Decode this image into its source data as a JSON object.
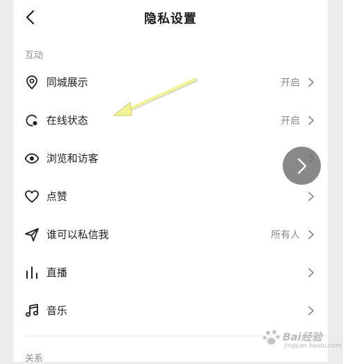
{
  "header": {
    "title": "隐私设置"
  },
  "sections": [
    {
      "label": "互动"
    },
    {
      "label": "关系"
    }
  ],
  "rows": [
    {
      "label": "同城展示",
      "value": "开启",
      "icon": "location-pin-icon"
    },
    {
      "label": "在线状态",
      "value": "开启",
      "icon": "online-status-icon"
    },
    {
      "label": "浏览和访客",
      "value": "",
      "icon": "eye-icon"
    },
    {
      "label": "点赞",
      "value": "",
      "icon": "heart-icon"
    },
    {
      "label": "谁可以私信我",
      "value": "所有人",
      "icon": "send-icon"
    },
    {
      "label": "直播",
      "value": "",
      "icon": "bars-icon"
    },
    {
      "label": "音乐",
      "value": "",
      "icon": "music-note-icon"
    }
  ],
  "watermark": {
    "text": "Bai经验",
    "sub": "jingyan.baidu.com"
  },
  "colors": {
    "accent_arrow": "#f3f39a",
    "text_secondary": "#8a8a8a",
    "float_button": "#6e6e6e"
  }
}
